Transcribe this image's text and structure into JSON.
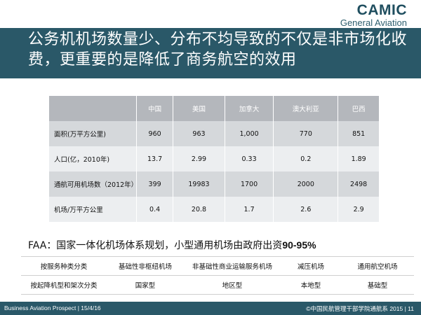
{
  "logo": {
    "main": "CAMIC",
    "sub": "General Aviation"
  },
  "title": "公务机机场数量少、分布不均导致的不仅是非市场化收费，更重要的是降低了商务航空的效用",
  "table1": {
    "columns": [
      "中国",
      "美国",
      "加拿大",
      "澳大利亚",
      "巴西"
    ],
    "rows": [
      {
        "label": "面积(万平方公里)",
        "values": [
          "960",
          "963",
          "1,000",
          "770",
          "851"
        ]
      },
      {
        "label": "人口(亿，2010年)",
        "values": [
          "13.7",
          "2.99",
          "0.33",
          "0.2",
          "1.89"
        ]
      },
      {
        "label": "通航可用机场数（2012年）",
        "values": [
          "399",
          "19983",
          "1700",
          "2000",
          "2498"
        ]
      },
      {
        "label": "机场/万平方公里",
        "values": [
          "0.4",
          "20.8",
          "1.7",
          "2.6",
          "2.9"
        ]
      }
    ]
  },
  "faa": {
    "prefix": "FAA",
    "text": "：国家一体化机场体系规划，小型通用机场由政府出资",
    "percent": "90-95%"
  },
  "table2": {
    "rows": [
      [
        "按服务种类分类",
        "基础性非枢纽机场",
        "非基础性商业运输服务机场",
        "减压机场",
        "通用航空机场"
      ],
      [
        "按起降机型和架次分类",
        "国家型",
        "地区型",
        "本地型",
        "基础型"
      ]
    ]
  },
  "footer": {
    "left": "Business Aviation Prospect | 15/4/16",
    "right": "©中国民航管理干部学院通航系 2015  |  11"
  }
}
